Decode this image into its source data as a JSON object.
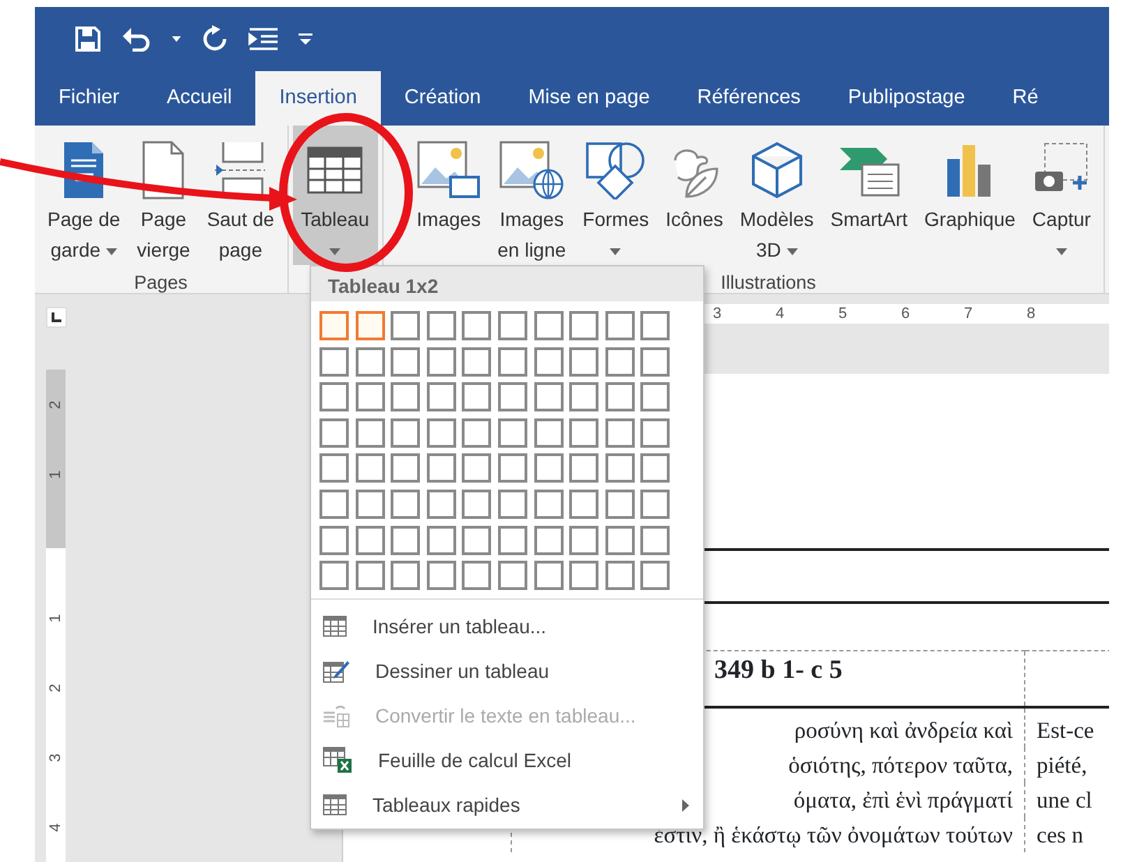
{
  "tabs": [
    {
      "label": "Fichier",
      "selected": false
    },
    {
      "label": "Accueil",
      "selected": false
    },
    {
      "label": "Insertion",
      "selected": true
    },
    {
      "label": "Création",
      "selected": false
    },
    {
      "label": "Mise en page",
      "selected": false
    },
    {
      "label": "Références",
      "selected": false
    },
    {
      "label": "Publipostage",
      "selected": false
    },
    {
      "label": "Ré",
      "selected": false
    }
  ],
  "ribbon": {
    "groups": [
      {
        "label": "Pages",
        "buttons": [
          {
            "lines": [
              "Page de",
              "garde"
            ],
            "dropdown": true,
            "pressed": false
          },
          {
            "lines": [
              "Page",
              "vierge"
            ],
            "dropdown": false,
            "pressed": false
          },
          {
            "lines": [
              "Saut de",
              "page"
            ],
            "dropdown": false,
            "pressed": false
          }
        ]
      },
      {
        "buttons": [
          {
            "lines": [
              "Tableau"
            ],
            "dropdown": true,
            "pressed": true
          }
        ]
      },
      {
        "label": "Illustrations",
        "buttons": [
          {
            "lines": [
              "Images"
            ],
            "dropdown": false,
            "pressed": false
          },
          {
            "lines": [
              "Images",
              "en ligne"
            ],
            "dropdown": false,
            "pressed": false
          },
          {
            "lines": [
              "Formes"
            ],
            "dropdown": true,
            "pressed": false
          },
          {
            "lines": [
              "Icônes"
            ],
            "dropdown": false,
            "pressed": false
          },
          {
            "lines": [
              "Modèles",
              "3D"
            ],
            "dropdown": true,
            "pressed": false
          },
          {
            "lines": [
              "SmartArt"
            ],
            "dropdown": false,
            "pressed": false
          },
          {
            "lines": [
              "Graphique"
            ],
            "dropdown": false,
            "pressed": false
          },
          {
            "lines": [
              "Captur"
            ],
            "dropdown": true,
            "pressed": false
          }
        ]
      }
    ]
  },
  "table_menu": {
    "title": "Tableau 1x2",
    "grid": [
      [
        true,
        true,
        false,
        false,
        false,
        false,
        false,
        false,
        false,
        false
      ],
      [
        false,
        false,
        false,
        false,
        false,
        false,
        false,
        false,
        false,
        false
      ],
      [
        false,
        false,
        false,
        false,
        false,
        false,
        false,
        false,
        false,
        false
      ],
      [
        false,
        false,
        false,
        false,
        false,
        false,
        false,
        false,
        false,
        false
      ],
      [
        false,
        false,
        false,
        false,
        false,
        false,
        false,
        false,
        false,
        false
      ],
      [
        false,
        false,
        false,
        false,
        false,
        false,
        false,
        false,
        false,
        false
      ],
      [
        false,
        false,
        false,
        false,
        false,
        false,
        false,
        false,
        false,
        false
      ],
      [
        false,
        false,
        false,
        false,
        false,
        false,
        false,
        false,
        false,
        false
      ]
    ],
    "items": [
      {
        "label": "Insérer un tableau...",
        "disabled": false,
        "submenu": false
      },
      {
        "label": "Dessiner un tableau",
        "disabled": false,
        "submenu": false
      },
      {
        "label": "Convertir le texte en tableau...",
        "disabled": true,
        "submenu": false
      },
      {
        "label": "Feuille de calcul Excel",
        "disabled": false,
        "submenu": false
      },
      {
        "label": "Tableaux rapides",
        "disabled": false,
        "submenu": true
      }
    ]
  },
  "horizontal_ruler": [
    "3",
    "4",
    "5",
    "6",
    "7",
    "8"
  ],
  "vertical_ruler": {
    "shaded": [
      "2",
      "1"
    ],
    "plain": [
      "1",
      "2",
      "3",
      "4"
    ]
  },
  "document": {
    "table": {
      "header": "349 b 1- c 5",
      "rows": [
        [
          "ροσύνη καὶ ἀνδρεία καὶ",
          "Est-ce"
        ],
        [
          "ὁσιότης, πότερον ταῦτα,",
          "piété,"
        ],
        [
          "όματα, ἐπὶ ἑνὶ πράγματί",
          "une cl"
        ],
        [
          "ἐστιν, ἢ ἑκάστῳ τῶν ὀνομάτων τούτων",
          "ces n"
        ]
      ]
    }
  }
}
